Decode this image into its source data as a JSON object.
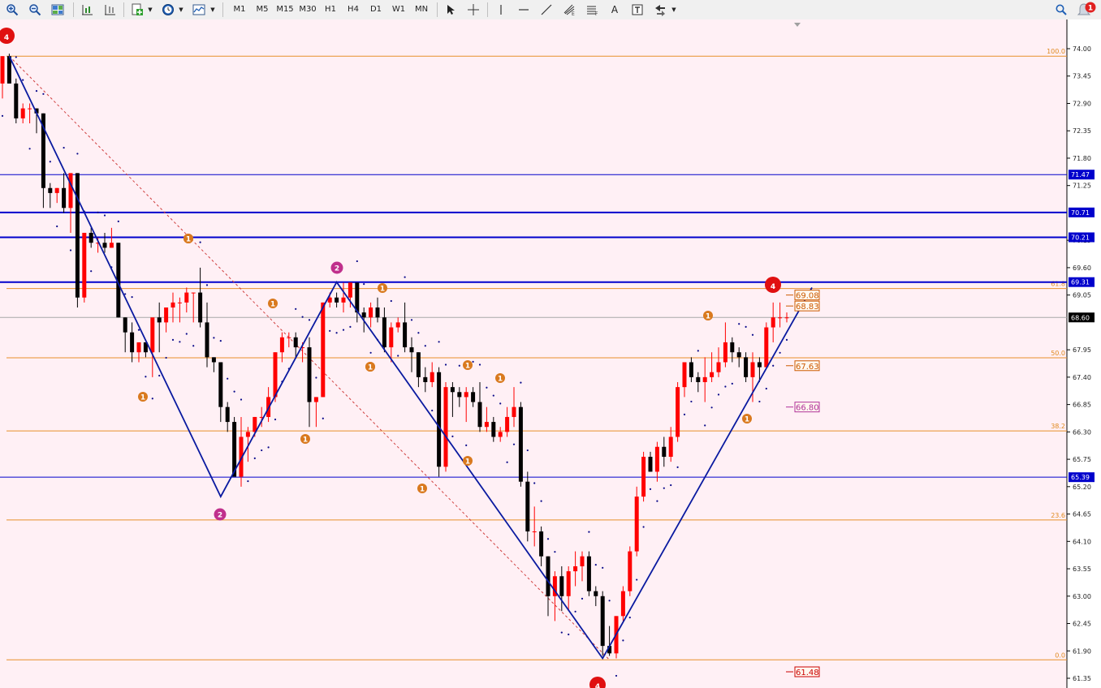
{
  "toolbar": {
    "timeframes": [
      "M1",
      "M5",
      "M15",
      "M30",
      "H1",
      "H4",
      "D1",
      "W1",
      "MN"
    ],
    "active_timeframe": "H4",
    "text_tool": "A",
    "notification_count": "1",
    "icons": [
      "zoom-in-icon",
      "zoom-out-icon",
      "tile-windows-icon",
      "period-separator-icon",
      "chart-shift-icon",
      "new-order-icon",
      "clock-icon",
      "chart-template-icon",
      "cursor-icon",
      "crosshair-icon",
      "vertical-line-icon",
      "horizontal-line-icon",
      "trendline-icon",
      "fibo-expansion-icon",
      "fibo-fan-icon",
      "text-icon",
      "text-label-icon",
      "arrows-icon",
      "search-icon",
      "alerts-icon"
    ]
  },
  "chart": {
    "background": "#fff0f5",
    "bull_color": "#ff0000",
    "bear_color": "#000000",
    "price_levels": [
      "74.00",
      "73.45",
      "72.90",
      "72.35",
      "71.80",
      "71.25",
      "70.15",
      "69.60",
      "69.05",
      "67.95",
      "67.40",
      "66.85",
      "66.30",
      "65.75",
      "65.20",
      "64.65",
      "64.10",
      "63.55",
      "63.00",
      "62.45",
      "61.90",
      "61.35"
    ],
    "price_axis": {
      "max": 74.0,
      "min": 61.35
    },
    "horizontal_lines": [
      {
        "price": 71.47,
        "label": "71.47",
        "color": "#0000cc",
        "width": 1
      },
      {
        "price": 70.71,
        "label": "70.71",
        "color": "#0000cc",
        "width": 2
      },
      {
        "price": 70.21,
        "label": "70.21",
        "color": "#0000cc",
        "width": 2
      },
      {
        "price": 69.31,
        "label": "69.31",
        "color": "#0000cc",
        "width": 2
      },
      {
        "price": 65.39,
        "label": "65.39",
        "color": "#0000cc",
        "width": 1
      }
    ],
    "current_price": {
      "price": 68.6,
      "label": "68.60"
    },
    "fib_levels": [
      {
        "price": 73.85,
        "label": "100.0"
      },
      {
        "price": 69.18,
        "label": "61.8"
      },
      {
        "price": 67.79,
        "label": "50.0"
      },
      {
        "price": 66.32,
        "label": "38.2"
      },
      {
        "price": 64.53,
        "label": "23.6"
      },
      {
        "price": 61.72,
        "label": "0.0"
      }
    ],
    "targets": [
      {
        "price": 69.05,
        "label": "69.08",
        "color": "#cc5a00"
      },
      {
        "price": 68.83,
        "label": "68.83",
        "color": "#cc5a00"
      },
      {
        "price": 67.63,
        "label": "67.63",
        "color": "#cc5a00"
      },
      {
        "price": 66.8,
        "label": "66.80",
        "color": "#b0309a"
      },
      {
        "price": 61.48,
        "label": "61.48",
        "color": "#cc0000"
      }
    ],
    "wave_labels": [
      {
        "text": "4",
        "kind": "major"
      },
      {
        "text": "1",
        "kind": "minor"
      },
      {
        "text": "2",
        "kind": "intermediate"
      },
      {
        "text": "1",
        "kind": "minor"
      },
      {
        "text": "1",
        "kind": "minor"
      },
      {
        "text": "1",
        "kind": "minor"
      },
      {
        "text": "2",
        "kind": "intermediate"
      },
      {
        "text": "1",
        "kind": "minor"
      },
      {
        "text": "1",
        "kind": "minor"
      },
      {
        "text": "1",
        "kind": "minor"
      },
      {
        "text": "1",
        "kind": "minor"
      },
      {
        "text": "1",
        "kind": "minor"
      },
      {
        "text": "1",
        "kind": "minor"
      },
      {
        "text": "1",
        "kind": "minor"
      },
      {
        "text": "1",
        "kind": "minor"
      },
      {
        "text": "4",
        "kind": "major"
      },
      {
        "text": "1",
        "kind": "minor"
      },
      {
        "text": "1",
        "kind": "minor"
      },
      {
        "text": "4",
        "kind": "major"
      }
    ],
    "zigzag_points": [
      [
        73.85,
        0
      ],
      [
        65.0,
        1
      ],
      [
        69.31,
        2
      ],
      [
        61.75,
        3
      ],
      [
        69.2,
        4
      ]
    ],
    "candles": [
      [
        73.3,
        73.85,
        73.0,
        73.85
      ],
      [
        73.85,
        73.9,
        73.3,
        73.3
      ],
      [
        73.3,
        73.4,
        72.5,
        72.6
      ],
      [
        72.6,
        72.9,
        72.5,
        72.8
      ],
      [
        72.8,
        72.9,
        72.5,
        72.8
      ],
      [
        72.8,
        72.8,
        72.3,
        72.7
      ],
      [
        72.7,
        72.7,
        70.8,
        71.2
      ],
      [
        71.2,
        71.3,
        70.8,
        71.1
      ],
      [
        71.1,
        71.2,
        70.9,
        71.2
      ],
      [
        71.2,
        71.5,
        70.7,
        70.8
      ],
      [
        70.8,
        71.3,
        70.3,
        71.5
      ],
      [
        71.5,
        71.5,
        68.8,
        69.0
      ],
      [
        69.0,
        70.3,
        68.9,
        70.3
      ],
      [
        70.3,
        70.4,
        70.0,
        70.1
      ],
      [
        70.1,
        70.2,
        69.9,
        70.1
      ],
      [
        70.1,
        70.3,
        69.9,
        70.0
      ],
      [
        70.0,
        70.4,
        70.0,
        70.1
      ],
      [
        70.1,
        70.1,
        68.6,
        68.6
      ],
      [
        68.6,
        68.6,
        67.9,
        68.3
      ],
      [
        68.3,
        68.5,
        67.7,
        67.9
      ],
      [
        67.9,
        68.0,
        67.7,
        68.1
      ],
      [
        68.1,
        68.1,
        67.8,
        67.9
      ],
      [
        67.9,
        68.5,
        67.4,
        68.6
      ],
      [
        68.6,
        68.9,
        67.9,
        68.5
      ],
      [
        68.5,
        68.8,
        68.3,
        68.8
      ],
      [
        68.8,
        69.1,
        68.5,
        68.9
      ],
      [
        68.9,
        69.0,
        68.5,
        68.9
      ],
      [
        68.9,
        69.2,
        68.7,
        69.1
      ],
      [
        69.1,
        69.1,
        68.5,
        69.1
      ],
      [
        69.1,
        69.6,
        68.4,
        68.5
      ],
      [
        68.5,
        68.9,
        67.6,
        67.8
      ],
      [
        67.8,
        67.8,
        67.5,
        67.7
      ],
      [
        67.7,
        67.7,
        66.5,
        66.8
      ],
      [
        66.8,
        66.9,
        66.3,
        66.5
      ],
      [
        66.5,
        66.6,
        65.7,
        65.4
      ],
      [
        65.4,
        66.6,
        65.2,
        66.2
      ],
      [
        66.2,
        66.4,
        65.7,
        66.3
      ],
      [
        66.3,
        66.6,
        66.2,
        66.6
      ],
      [
        66.6,
        66.8,
        66.4,
        66.6
      ],
      [
        66.6,
        67.2,
        66.5,
        67.0
      ],
      [
        67.0,
        67.9,
        66.9,
        67.9
      ],
      [
        67.9,
        68.3,
        67.7,
        68.2
      ],
      [
        68.2,
        68.3,
        68.0,
        68.2
      ],
      [
        68.2,
        68.3,
        67.8,
        68.0
      ],
      [
        68.0,
        68.1,
        67.7,
        68.0
      ],
      [
        68.0,
        68.2,
        66.4,
        66.9
      ],
      [
        66.9,
        67.0,
        66.4,
        67.0
      ],
      [
        67.0,
        68.9,
        67.0,
        68.9
      ],
      [
        68.9,
        69.1,
        68.8,
        69.0
      ],
      [
        69.0,
        69.1,
        68.8,
        68.9
      ],
      [
        68.9,
        69.3,
        68.7,
        69.0
      ],
      [
        69.0,
        69.3,
        68.8,
        69.3
      ],
      [
        69.3,
        69.3,
        68.5,
        68.7
      ],
      [
        68.7,
        68.8,
        68.3,
        68.6
      ],
      [
        68.6,
        68.9,
        68.4,
        68.8
      ],
      [
        68.8,
        69.0,
        68.5,
        68.6
      ],
      [
        68.6,
        68.8,
        67.9,
        68.0
      ],
      [
        68.0,
        68.5,
        67.7,
        68.4
      ],
      [
        68.4,
        68.6,
        68.3,
        68.5
      ],
      [
        68.5,
        68.9,
        67.9,
        68.0
      ],
      [
        68.0,
        68.2,
        67.5,
        67.9
      ],
      [
        67.9,
        67.9,
        67.2,
        67.4
      ],
      [
        67.4,
        67.6,
        67.1,
        67.3
      ],
      [
        67.3,
        67.7,
        67.2,
        67.5
      ],
      [
        67.5,
        67.6,
        65.4,
        65.6
      ],
      [
        65.6,
        67.3,
        65.5,
        67.2
      ],
      [
        67.2,
        67.3,
        66.6,
        67.1
      ],
      [
        67.1,
        67.2,
        66.8,
        67.0
      ],
      [
        67.0,
        67.2,
        66.5,
        67.1
      ],
      [
        67.1,
        67.2,
        66.8,
        66.9
      ],
      [
        66.9,
        67.3,
        66.3,
        66.4
      ],
      [
        66.4,
        66.8,
        66.3,
        66.5
      ],
      [
        66.5,
        66.6,
        66.1,
        66.2
      ],
      [
        66.2,
        66.4,
        66.1,
        66.3
      ],
      [
        66.3,
        66.8,
        66.2,
        66.6
      ],
      [
        66.6,
        67.2,
        66.4,
        66.8
      ],
      [
        66.8,
        66.9,
        65.2,
        65.3
      ],
      [
        65.3,
        65.5,
        64.1,
        64.3
      ],
      [
        64.3,
        64.8,
        64.0,
        64.3
      ],
      [
        64.3,
        64.4,
        63.6,
        63.8
      ],
      [
        63.8,
        63.8,
        62.6,
        63.0
      ],
      [
        63.0,
        63.5,
        62.5,
        63.4
      ],
      [
        63.4,
        63.6,
        62.7,
        63.0
      ],
      [
        63.0,
        63.6,
        62.7,
        63.5
      ],
      [
        63.5,
        63.9,
        63.2,
        63.6
      ],
      [
        63.6,
        63.9,
        63.3,
        63.8
      ],
      [
        63.8,
        63.9,
        63.0,
        63.1
      ],
      [
        63.1,
        63.2,
        62.8,
        63.0
      ],
      [
        63.0,
        63.1,
        61.8,
        62.0
      ],
      [
        62.0,
        62.4,
        61.8,
        61.85
      ],
      [
        61.85,
        62.6,
        61.75,
        62.6
      ],
      [
        62.6,
        63.2,
        62.5,
        63.1
      ],
      [
        63.1,
        64.0,
        63.0,
        63.9
      ],
      [
        63.9,
        65.2,
        63.8,
        65.0
      ],
      [
        65.0,
        65.9,
        64.9,
        65.8
      ],
      [
        65.8,
        65.9,
        65.5,
        65.5
      ],
      [
        65.5,
        66.1,
        65.3,
        66.0
      ],
      [
        66.0,
        66.2,
        65.6,
        65.8
      ],
      [
        65.8,
        66.4,
        65.7,
        66.2
      ],
      [
        66.2,
        67.3,
        66.1,
        67.2
      ],
      [
        67.2,
        67.7,
        67.0,
        67.7
      ],
      [
        67.7,
        67.8,
        67.3,
        67.4
      ],
      [
        67.4,
        67.5,
        67.1,
        67.3
      ],
      [
        67.3,
        67.8,
        66.9,
        67.4
      ],
      [
        67.4,
        67.9,
        67.3,
        67.5
      ],
      [
        67.5,
        68.0,
        67.4,
        67.7
      ],
      [
        67.7,
        68.5,
        67.6,
        68.1
      ],
      [
        68.1,
        68.2,
        67.7,
        67.9
      ],
      [
        67.9,
        68.0,
        67.6,
        67.8
      ],
      [
        67.8,
        67.9,
        67.3,
        67.4
      ],
      [
        67.4,
        67.9,
        66.9,
        67.7
      ],
      [
        67.7,
        67.8,
        67.3,
        67.6
      ],
      [
        67.6,
        68.5,
        67.6,
        68.4
      ],
      [
        68.4,
        68.9,
        68.1,
        68.6
      ],
      [
        68.6,
        68.9,
        68.4,
        68.6
      ],
      [
        68.6,
        68.7,
        68.5,
        68.6
      ]
    ]
  }
}
